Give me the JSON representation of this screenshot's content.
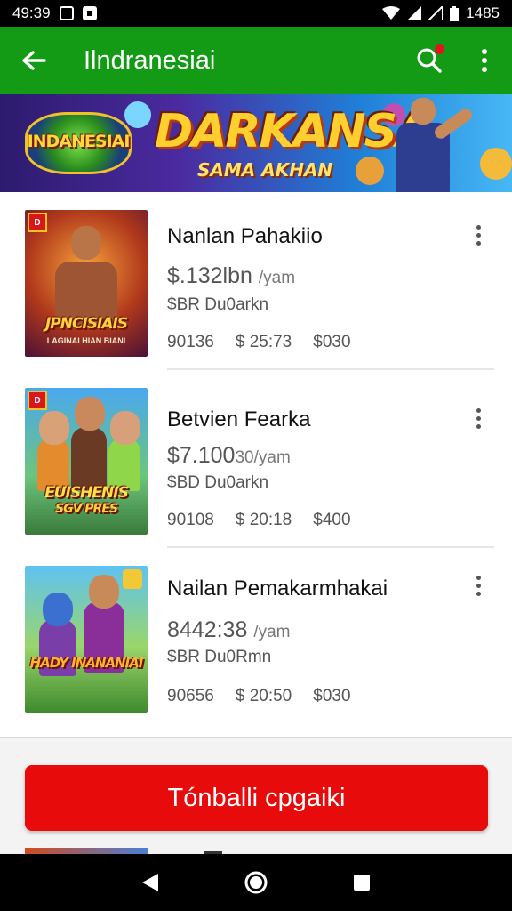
{
  "status_bar": {
    "time": "49:39",
    "right_text": "1485"
  },
  "app_bar": {
    "title": "Ilndranesiai"
  },
  "banner": {
    "logo_text": "INDANESIAI",
    "headline": "DARKANSA",
    "subline": "SAMA AKHAN"
  },
  "items": [
    {
      "title": "Nanlan Pahakiio",
      "price": "$.132lbn",
      "price_unit": "/yam",
      "sub": "$BR Du0arkn",
      "stats": [
        "90136",
        "$ 25:73",
        "$030"
      ],
      "thumb_title": "JPNCISIAIS",
      "thumb_subtitle": "LAGINAI HIAN BIANI",
      "badge": "D"
    },
    {
      "title": "Betvien Fearka",
      "price": "$7.100",
      "price_unit": "30/yam",
      "sub": "$BD Du0arkn",
      "stats": [
        "90108",
        "$ 20:18",
        "$400"
      ],
      "thumb_title": "EUISHENIS",
      "thumb_subtitle": "SGV PRES",
      "badge": "D"
    },
    {
      "title": "Nailan Pemakarmhakai",
      "price": "8442:38",
      "price_unit": "/yam",
      "sub": "$BR Du0Rmn",
      "stats": [
        "90656",
        "$ 20:50",
        "$030"
      ],
      "thumb_title": "HADY INANANIAI",
      "thumb_subtitle": "",
      "badge": ""
    }
  ],
  "cta": {
    "label": "Tónballi cpgaiki"
  },
  "colors": {
    "app_bar": "#149b15",
    "cta": "#e80b0c",
    "notification_dot": "#e3141b"
  },
  "icons": {
    "back": "arrow-left-icon",
    "search": "search-icon",
    "more": "more-vert-icon",
    "nav_back": "triangle-back-icon",
    "nav_home": "circle-home-icon",
    "nav_recents": "square-recents-icon"
  }
}
